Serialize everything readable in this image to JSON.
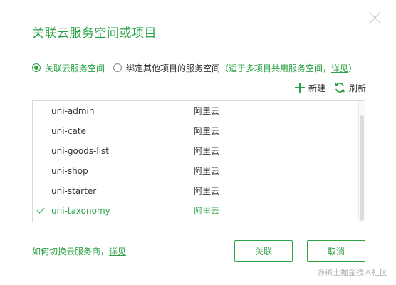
{
  "dialog": {
    "title": "关联云服务空间或项目"
  },
  "radio": {
    "option1": "关联云服务空间",
    "option2": "绑定其他项目的服务空间",
    "option2_note_prefix": "（适于多项目共用服务空间，",
    "option2_note_link": "详见",
    "option2_note_suffix": "）"
  },
  "actions": {
    "new_label": "新建",
    "refresh_label": "刷新"
  },
  "spaces": [
    {
      "name": "uni-admin",
      "provider": "阿里云",
      "selected": false
    },
    {
      "name": "uni-cate",
      "provider": "阿里云",
      "selected": false
    },
    {
      "name": "uni-goods-list",
      "provider": "阿里云",
      "selected": false
    },
    {
      "name": "uni-shop",
      "provider": "阿里云",
      "selected": false
    },
    {
      "name": "uni-starter",
      "provider": "阿里云",
      "selected": false
    },
    {
      "name": "uni-taxonomy",
      "provider": "阿里云",
      "selected": true
    }
  ],
  "footer": {
    "switch_text": "如何切换云服务商，",
    "switch_link": "详见",
    "ok_label": "关联",
    "cancel_label": "取消"
  },
  "watermark": "@稀土掘金技术社区",
  "colors": {
    "accent": "#2ba245",
    "text": "#333333",
    "border": "#d9d9d9"
  }
}
